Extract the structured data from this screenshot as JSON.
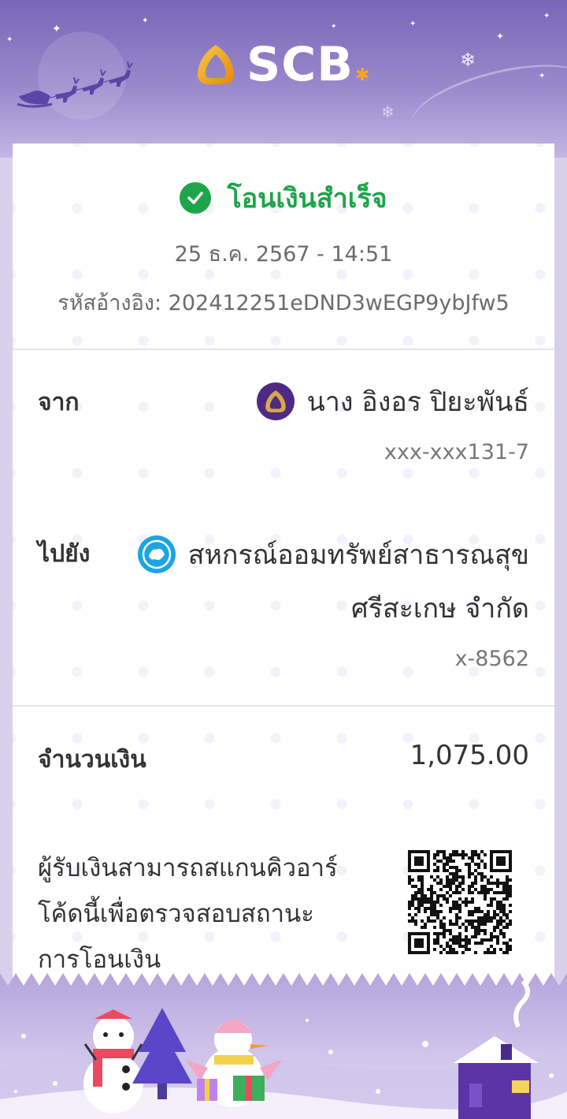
{
  "header": {
    "brand": "SCB"
  },
  "status": {
    "text": "โอนเงินสำเร็จ",
    "color": "#1ea44a",
    "icon": "check-circle-icon"
  },
  "transaction": {
    "datetime": "25 ธ.ค. 2567 - 14:51",
    "reference": "รหัสอ้างอิง: 202412251eDND3wEGP9ybJfw5"
  },
  "from": {
    "label": "จาก",
    "name": "นาง อิงอร ปิยะพันธ์",
    "account": "xxx-xxx131-7",
    "bank_icon": "scb-bank-icon"
  },
  "to": {
    "label": "ไปยัง",
    "name_line1": "สหกรณ์ออมทรัพย์สาธารณสุข",
    "name_line2": "ศรีสะเกษ จำกัด",
    "account": "x-8562",
    "bank_icon": "krungthai-bank-icon"
  },
  "amount": {
    "label": "จำนวนเงิน",
    "value": "1,075.00"
  },
  "qr_note": {
    "line1": "ผู้รับเงินสามารถสแกนคิวอาร์",
    "line2": "โค้ดนี้เพื่อตรวจสอบสถานะ",
    "line3": "การโอนเงิน"
  }
}
